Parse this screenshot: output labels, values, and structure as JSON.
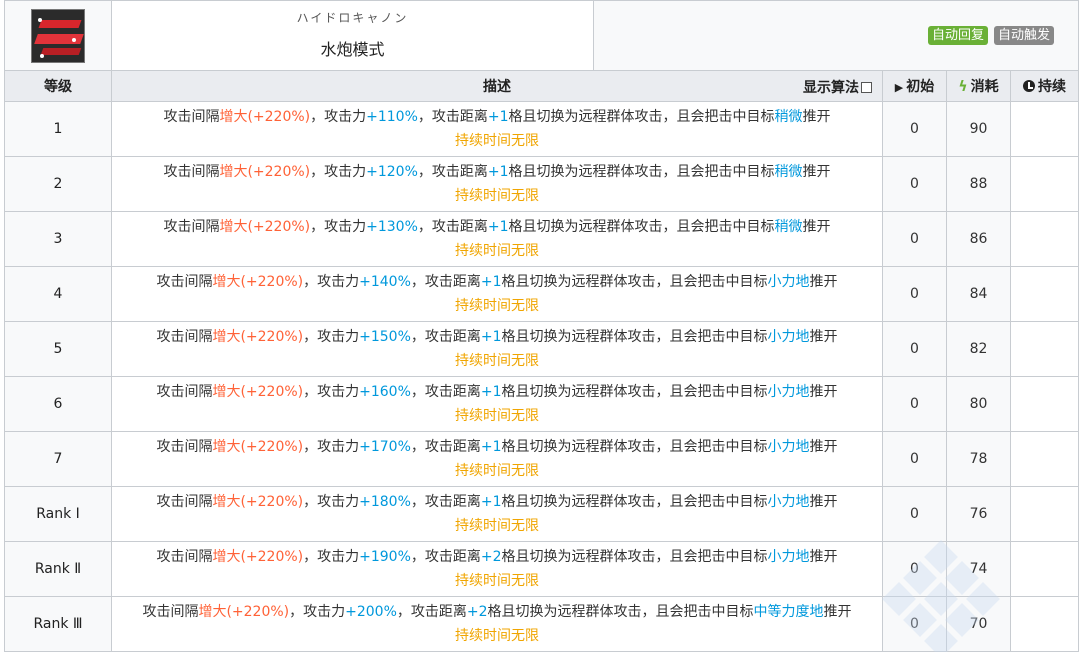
{
  "skill": {
    "icon": "water-cannon-skill-icon",
    "jp_name": "ハイドロキャノン",
    "cn_name": "水炮模式",
    "tags": [
      {
        "label": "自动回复",
        "color": "#6ab036"
      },
      {
        "label": "自动触发",
        "color": "#888888"
      }
    ]
  },
  "columns": {
    "level": "等级",
    "description": "描述",
    "algo_toggle": "显示算法",
    "initial": "初始",
    "cost": "消耗",
    "duration": "持续"
  },
  "rows": [
    {
      "level": "1",
      "d1": "攻击间隔",
      "d2": "增大(+220%)",
      "d3": "，攻击力",
      "d4": "+110%",
      "d5": "，攻击距离",
      "d6": "+1",
      "d7": "格且切换为远程群体攻击，且会把击中目标",
      "d8": "稍微",
      "d9": "推开",
      "dur": "持续时间无限",
      "initial": "0",
      "cost": "90"
    },
    {
      "level": "2",
      "d1": "攻击间隔",
      "d2": "增大(+220%)",
      "d3": "，攻击力",
      "d4": "+120%",
      "d5": "，攻击距离",
      "d6": "+1",
      "d7": "格且切换为远程群体攻击，且会把击中目标",
      "d8": "稍微",
      "d9": "推开",
      "dur": "持续时间无限",
      "initial": "0",
      "cost": "88"
    },
    {
      "level": "3",
      "d1": "攻击间隔",
      "d2": "增大(+220%)",
      "d3": "，攻击力",
      "d4": "+130%",
      "d5": "，攻击距离",
      "d6": "+1",
      "d7": "格且切换为远程群体攻击，且会把击中目标",
      "d8": "稍微",
      "d9": "推开",
      "dur": "持续时间无限",
      "initial": "0",
      "cost": "86"
    },
    {
      "level": "4",
      "d1": "攻击间隔",
      "d2": "增大(+220%)",
      "d3": "，攻击力",
      "d4": "+140%",
      "d5": "，攻击距离",
      "d6": "+1",
      "d7": "格且切换为远程群体攻击，且会把击中目标",
      "d8": "小力地",
      "d9": "推开",
      "dur": "持续时间无限",
      "initial": "0",
      "cost": "84"
    },
    {
      "level": "5",
      "d1": "攻击间隔",
      "d2": "增大(+220%)",
      "d3": "，攻击力",
      "d4": "+150%",
      "d5": "，攻击距离",
      "d6": "+1",
      "d7": "格且切换为远程群体攻击，且会把击中目标",
      "d8": "小力地",
      "d9": "推开",
      "dur": "持续时间无限",
      "initial": "0",
      "cost": "82"
    },
    {
      "level": "6",
      "d1": "攻击间隔",
      "d2": "增大(+220%)",
      "d3": "，攻击力",
      "d4": "+160%",
      "d5": "，攻击距离",
      "d6": "+1",
      "d7": "格且切换为远程群体攻击，且会把击中目标",
      "d8": "小力地",
      "d9": "推开",
      "dur": "持续时间无限",
      "initial": "0",
      "cost": "80"
    },
    {
      "level": "7",
      "d1": "攻击间隔",
      "d2": "增大(+220%)",
      "d3": "，攻击力",
      "d4": "+170%",
      "d5": "，攻击距离",
      "d6": "+1",
      "d7": "格且切换为远程群体攻击，且会把击中目标",
      "d8": "小力地",
      "d9": "推开",
      "dur": "持续时间无限",
      "initial": "0",
      "cost": "78"
    },
    {
      "level": "Rank Ⅰ",
      "d1": "攻击间隔",
      "d2": "增大(+220%)",
      "d3": "，攻击力",
      "d4": "+180%",
      "d5": "，攻击距离",
      "d6": "+1",
      "d7": "格且切换为远程群体攻击，且会把击中目标",
      "d8": "小力地",
      "d9": "推开",
      "dur": "持续时间无限",
      "initial": "0",
      "cost": "76"
    },
    {
      "level": "Rank Ⅱ",
      "d1": "攻击间隔",
      "d2": "增大(+220%)",
      "d3": "，攻击力",
      "d4": "+190%",
      "d5": "，攻击距离",
      "d6": "+2",
      "d7": "格且切换为远程群体攻击，且会把击中目标",
      "d8": "小力地",
      "d9": "推开",
      "dur": "持续时间无限",
      "initial": "0",
      "cost": "74"
    },
    {
      "level": "Rank Ⅲ",
      "d1": "攻击间隔",
      "d2": "增大(+220%)",
      "d3": "，攻击力",
      "d4": "+200%",
      "d5": "，攻击距离",
      "d6": "+2",
      "d7": "格且切换为远程群体攻击，且会把击中目标",
      "d8": "中等力度地",
      "d9": "推开",
      "dur": "持续时间无限",
      "initial": "0",
      "cost": "70"
    }
  ],
  "colors": {
    "negative": "#ff6237",
    "positive": "#0098dc",
    "duration": "#f0a500",
    "header_bg": "#eaecf0"
  }
}
